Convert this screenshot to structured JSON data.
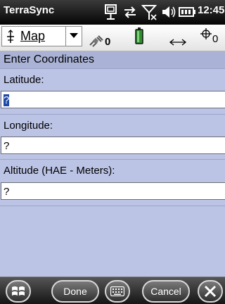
{
  "status_bar": {
    "app_title": "TerraSync",
    "time": "12:45",
    "icons": [
      "connection-icon",
      "sync-icon",
      "no-signal-icon",
      "volume-icon",
      "battery-icon"
    ]
  },
  "toolbar": {
    "view_label": "Map",
    "satellites_used": "0",
    "satellites_visible": "0",
    "icons": [
      "map-pin-icon",
      "dropdown-arrow-icon",
      "satellite-icon",
      "battery-icon",
      "arrows-icon",
      "satellite-crosshair-icon"
    ]
  },
  "form": {
    "title": "Enter Coordinates",
    "fields": [
      {
        "label": "Latitude:",
        "value": "?",
        "selected": true
      },
      {
        "label": "Longitude:",
        "value": "?"
      },
      {
        "label": "Altitude (HAE - Meters):",
        "value": "?"
      }
    ]
  },
  "softkeys": {
    "done": "Done",
    "cancel": "Cancel",
    "icons": [
      "windows-start-icon",
      "keyboard-icon",
      "close-icon"
    ]
  },
  "colors": {
    "form_background": "#bcc4e6",
    "title_background": "#aab3d6",
    "selection": "#1f4aa8"
  }
}
